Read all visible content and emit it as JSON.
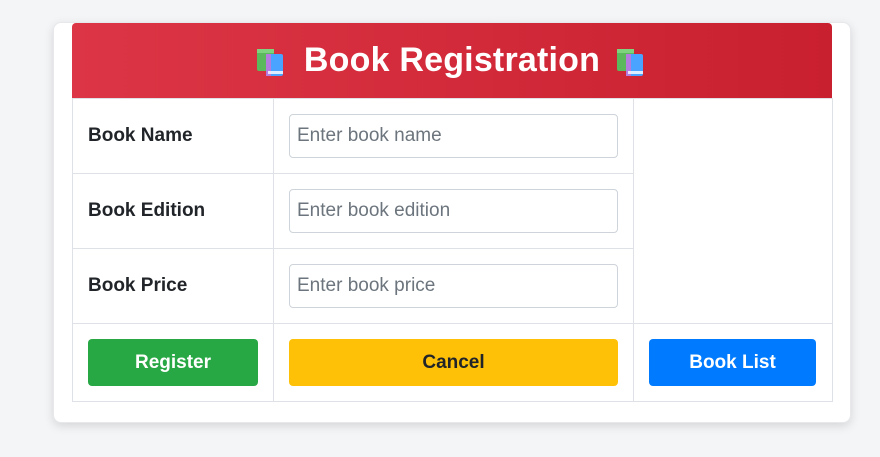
{
  "header": {
    "title": "Book Registration",
    "left_icon": "books-icon",
    "right_icon": "books-icon"
  },
  "fields": [
    {
      "label": "Book Name",
      "placeholder": "Enter book name",
      "value": ""
    },
    {
      "label": "Book Edition",
      "placeholder": "Enter book edition",
      "value": ""
    },
    {
      "label": "Book Price",
      "placeholder": "Enter book price",
      "value": ""
    }
  ],
  "actions": {
    "register": "Register",
    "cancel": "Cancel",
    "book_list": "Book List"
  },
  "colors": {
    "header": "#dc3545",
    "register": "#28a745",
    "cancel": "#ffc107",
    "book_list": "#007bff"
  }
}
